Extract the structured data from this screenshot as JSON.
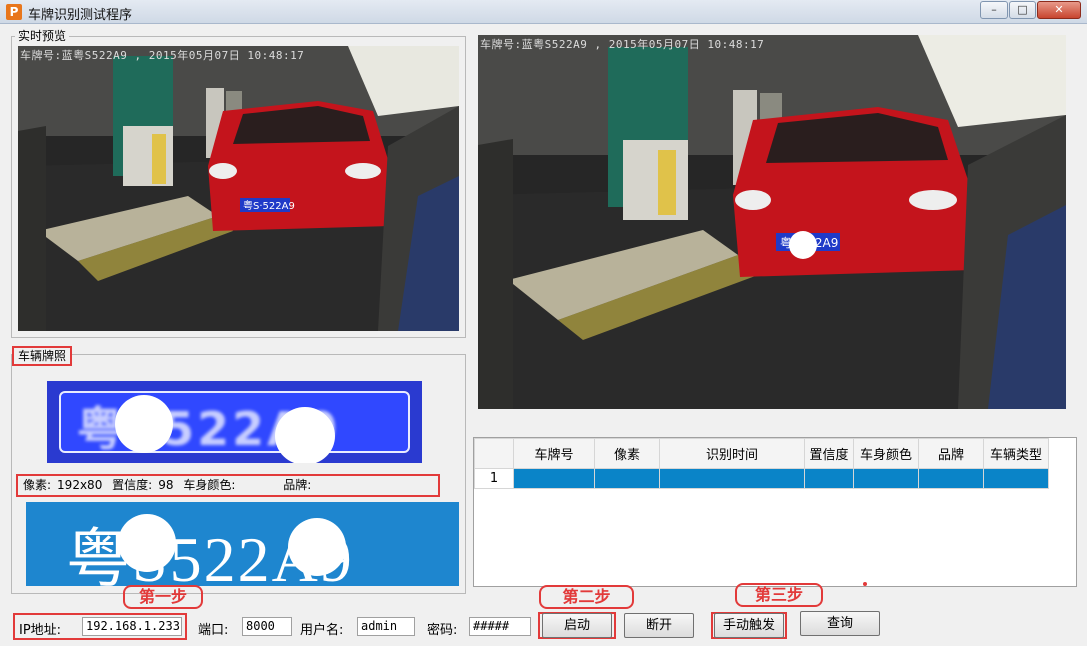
{
  "window": {
    "title": "车牌识别测试程序",
    "icon_letter": "P",
    "buttons": {
      "minimize": "–",
      "maximize": "□",
      "close": "✕"
    }
  },
  "live_preview": {
    "label": "实时预览",
    "overlay_text": "车牌号:蓝粤S522A9 , 2015年05月07日 10:48:17",
    "plate_on_car": "粤S·522A9"
  },
  "capture_view": {
    "overlay_text": "车牌号:蓝粤S522A9 , 2015年05月07日 10:48:17",
    "plate_on_car": "粤S522A9"
  },
  "plate_section": {
    "label": "车辆牌照",
    "crop_text": "粤S522A9",
    "binary_text": "粤S522A9",
    "info": {
      "pixels_label": "像素:",
      "pixels": "192x80",
      "confidence_label": "置信度:",
      "confidence": "98",
      "color_label": "车身颜色:",
      "color": "",
      "brand_label": "品牌:",
      "brand": ""
    }
  },
  "results_table": {
    "columns": [
      "",
      "车牌号",
      "像素",
      "识别时间",
      "置信度",
      "车身颜色",
      "品牌",
      "车辆类型"
    ],
    "rows": [
      {
        "index": "1",
        "cells": [
          "",
          "",
          "",
          "",
          "",
          "",
          ""
        ],
        "selected": true
      }
    ]
  },
  "steps": {
    "step1": "第一步",
    "step2": "第二步",
    "step3": "第三步"
  },
  "connection": {
    "ip_label": "IP地址:",
    "ip": "192.168.1.233",
    "port_label": "端口:",
    "port": "8000",
    "user_label": "用户名:",
    "user": "admin",
    "password_label": "密码:",
    "password": "#####"
  },
  "actions": {
    "start": "启动",
    "disconnect": "断开",
    "manual_trigger": "手动触发",
    "query": "查询"
  },
  "colors": {
    "accent_red": "#e23a3a",
    "plate_blue": "#1e86cf",
    "selection_blue": "#0a84c8"
  }
}
